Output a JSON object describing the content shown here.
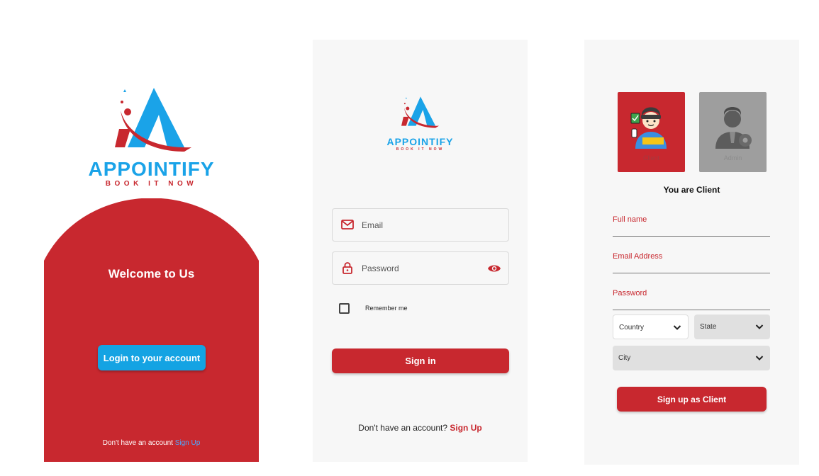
{
  "colors": {
    "brand_red": "#c8282f",
    "brand_blue": "#1aa3e8",
    "login_button": "#14a3e3",
    "link_blue": "#4da9ff",
    "admin_gray": "#9e9e9e",
    "panel_bg": "#f7f7f7"
  },
  "brand": {
    "name": "APPOINTIFY",
    "tagline": "BOOK IT NOW",
    "logo_icon": "appointify-logo-icon"
  },
  "welcome_screen": {
    "heading": "Welcome to Us",
    "login_button": "Login to your account",
    "footer_text": "Don't have an account",
    "footer_link": "Sign Up"
  },
  "signin_screen": {
    "email_placeholder": "Email",
    "email_icon": "mail-icon",
    "password_placeholder": "Password",
    "password_icon": "lock-icon",
    "password_toggle_icon": "eye-icon",
    "remember_label": "Remember me",
    "remember_checked": false,
    "signin_button": "Sign in",
    "footer_text": "Don't have an account?",
    "footer_link": "Sign Up"
  },
  "signup_screen": {
    "roles": [
      {
        "label": "Client",
        "icon": "client-avatar-icon",
        "selected": true
      },
      {
        "label": "Admin",
        "icon": "admin-avatar-icon",
        "selected": false
      }
    ],
    "role_heading": "You are Client",
    "fields": {
      "full_name": "Full name",
      "email": "Email Address",
      "password": "Password"
    },
    "selects": {
      "country": "Country",
      "state": "State",
      "city": "City"
    },
    "submit_button": "Sign up as Client"
  }
}
